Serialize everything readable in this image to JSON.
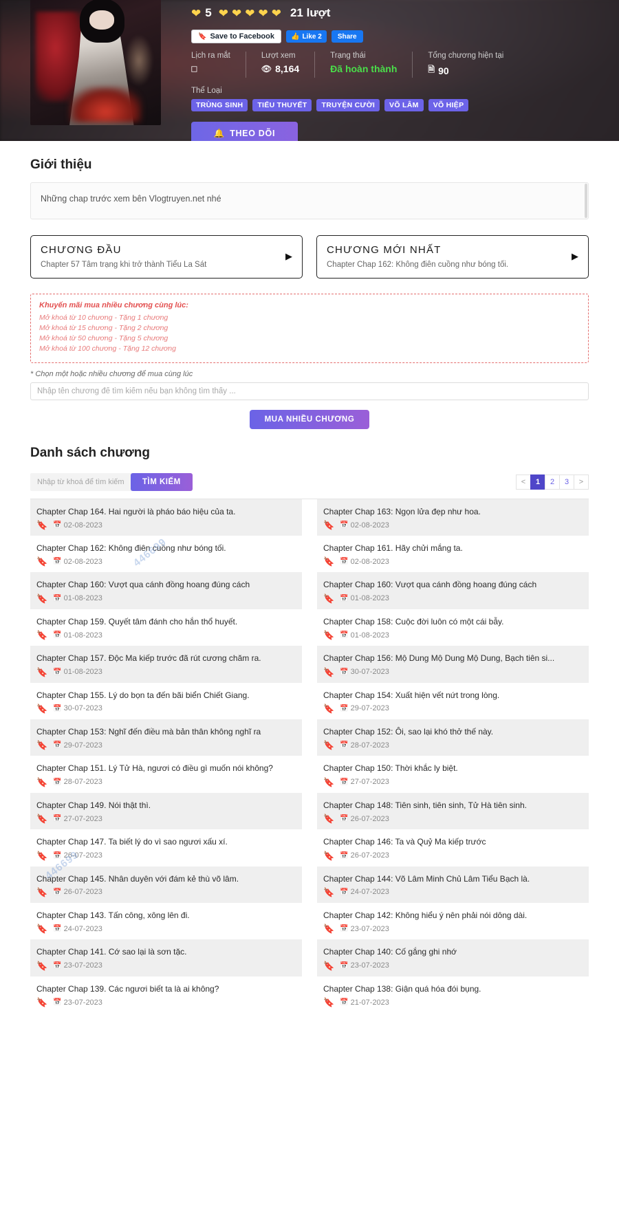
{
  "hero": {
    "rating": {
      "score": "5",
      "votes_text": "21 lượt",
      "hearts_count": 6,
      "heart_icon": "heart-icon",
      "heart_color": "#ffd34d"
    },
    "social": {
      "save_label": "Save to Facebook",
      "save_icon": "bookmark-icon",
      "like_label": "Like 2",
      "like_icon": "thumbs-up-icon",
      "share_label": "Share"
    },
    "meta": [
      {
        "label": "Lịch ra mắt",
        "value": "",
        "icon": "calendar-card-icon"
      },
      {
        "label": "Lượt xem",
        "value": "8,164",
        "icon": "eye-icon"
      },
      {
        "label": "Trạng thái",
        "value": "Đã hoàn thành",
        "icon": "",
        "color": "#4ade4a"
      },
      {
        "label": "Tổng chương hiện tại",
        "value": "90",
        "icon": "book-icon"
      }
    ],
    "genre_label": "Thể Loại",
    "genres": [
      "TRÙNG SINH",
      "TIỂU THUYẾT",
      "TRUYỆN CƯỜI",
      "VÕ LÂM",
      "VÕ HIỆP"
    ],
    "follow_button": {
      "label": "THEO DÕI",
      "icon": "bell-icon"
    }
  },
  "intro": {
    "title": "Giới thiệu",
    "text": "Những chap trước xem bên Vlogtruyen.net nhé"
  },
  "nav_cards": [
    {
      "title": "CHƯƠNG ĐẦU",
      "subtitle": "Chapter 57 Tâm trạng khi trở thành Tiểu La Sát",
      "arrow_icon": "play-arrow-icon"
    },
    {
      "title": "CHƯƠNG MỚI NHẤT",
      "subtitle": "Chapter Chap 162: Không điên cuồng như bóng tối.",
      "arrow_icon": "play-arrow-icon"
    }
  ],
  "promo": {
    "title": "Khuyến mãi mua nhiều chương cùng lúc:",
    "lines": [
      "Mở khoá từ 10 chương - Tặng 1 chương",
      "Mở khoá từ 15 chương - Tặng 2 chương",
      "Mở khoá từ 50 chương - Tặng 5 chương",
      "Mở khoá từ 100 chương - Tặng 12 chương"
    ],
    "accent_color": "#e35050"
  },
  "buy": {
    "hint": "* Chọn một hoặc nhiều chương để mua cùng lúc",
    "input_placeholder": "Nhập tên chương để tìm kiếm nếu bạn không tìm thấy ...",
    "input_value": "",
    "button_label": "MUA NHIỀU CHƯƠNG"
  },
  "chapter_list": {
    "title": "Danh sách chương",
    "search_placeholder": "Nhập từ khoá để tìm kiếm ...",
    "search_value": "",
    "search_button": "TÌM KIẾM",
    "pagination": {
      "prev": "<",
      "next": ">",
      "pages": [
        "1",
        "2",
        "3"
      ],
      "active": "1",
      "active_color": "#4f46c9"
    },
    "bookmark_icon": "bookmark-icon",
    "date_icon": "calendar-icon",
    "items": [
      {
        "title": "Chapter Chap 164. Hai người là pháo báo hiệu của ta.",
        "date": "02-08-2023"
      },
      {
        "title": "Chapter Chap 163: Ngọn lửa đẹp như hoa.",
        "date": "02-08-2023"
      },
      {
        "title": "Chapter Chap 162: Không điên cuồng như bóng tối.",
        "date": "02-08-2023"
      },
      {
        "title": "Chapter Chap 161. Hãy chửi mắng ta.",
        "date": "02-08-2023"
      },
      {
        "title": "Chapter Chap 160: Vượt qua cánh đồng hoang đúng cách",
        "date": "01-08-2023"
      },
      {
        "title": "Chapter Chap 160: Vượt qua cánh đồng hoang đúng cách",
        "date": "01-08-2023"
      },
      {
        "title": "Chapter Chap 159. Quyết tâm đánh cho hắn thổ huyết.",
        "date": "01-08-2023"
      },
      {
        "title": "Chapter Chap 158: Cuộc đời luôn có một cái bẫy.",
        "date": "01-08-2023"
      },
      {
        "title": "Chapter Chap 157. Độc Ma kiếp trước đã rút cương chăm ra.",
        "date": "01-08-2023"
      },
      {
        "title": "Chapter Chap 156: Mộ Dung Mộ Dung Mộ Dung, Bạch tiên si...",
        "date": "30-07-2023"
      },
      {
        "title": "Chapter Chap 155. Lý do bọn ta đến bãi biển Chiết Giang.",
        "date": "30-07-2023"
      },
      {
        "title": "Chapter Chap 154: Xuất hiện vết nứt trong lòng.",
        "date": "29-07-2023"
      },
      {
        "title": "Chapter Chap 153: Nghĩ đến điều mà bản thân không nghĩ ra",
        "date": "29-07-2023"
      },
      {
        "title": "Chapter Chap 152: Ôi, sao lại khó thở thế này.",
        "date": "28-07-2023"
      },
      {
        "title": "Chapter Chap 151. Lý Tử Hà, ngươi có điều gì muốn nói không?",
        "date": "28-07-2023"
      },
      {
        "title": "Chapter Chap 150: Thời khắc ly biệt.",
        "date": "27-07-2023"
      },
      {
        "title": "Chapter Chap 149. Nói thật thì.",
        "date": "27-07-2023"
      },
      {
        "title": "Chapter Chap 148: Tiên sinh, tiên sinh, Tử Hà tiên sinh.",
        "date": "26-07-2023"
      },
      {
        "title": "Chapter Chap 147. Ta biết lý do vì sao ngươi xấu xí.",
        "date": "26-07-2023"
      },
      {
        "title": "Chapter Chap 146: Ta và Quỷ Ma kiếp trước",
        "date": "26-07-2023"
      },
      {
        "title": "Chapter Chap 145. Nhân duyên với đám kẻ thù võ lâm.",
        "date": "26-07-2023"
      },
      {
        "title": "Chapter Chap 144: Võ Lâm Minh Chủ Lâm Tiểu Bạch là.",
        "date": "24-07-2023"
      },
      {
        "title": "Chapter Chap 143. Tấn công, xông lên đi.",
        "date": "24-07-2023"
      },
      {
        "title": "Chapter Chap 142: Không hiểu ý nên phải nói dông dài.",
        "date": "23-07-2023"
      },
      {
        "title": "Chapter Chap 141. Cớ sao lại là sơn tặc.",
        "date": "23-07-2023"
      },
      {
        "title": "Chapter Chap 140: Cố gắng ghi nhớ",
        "date": "23-07-2023"
      },
      {
        "title": "Chapter Chap 139. Các ngươi biết ta là ai không?",
        "date": "23-07-2023"
      },
      {
        "title": "Chapter Chap 138: Giận quá hóa đói bụng.",
        "date": "21-07-2023"
      }
    ]
  },
  "watermarks": [
    "446699",
    "446699"
  ]
}
